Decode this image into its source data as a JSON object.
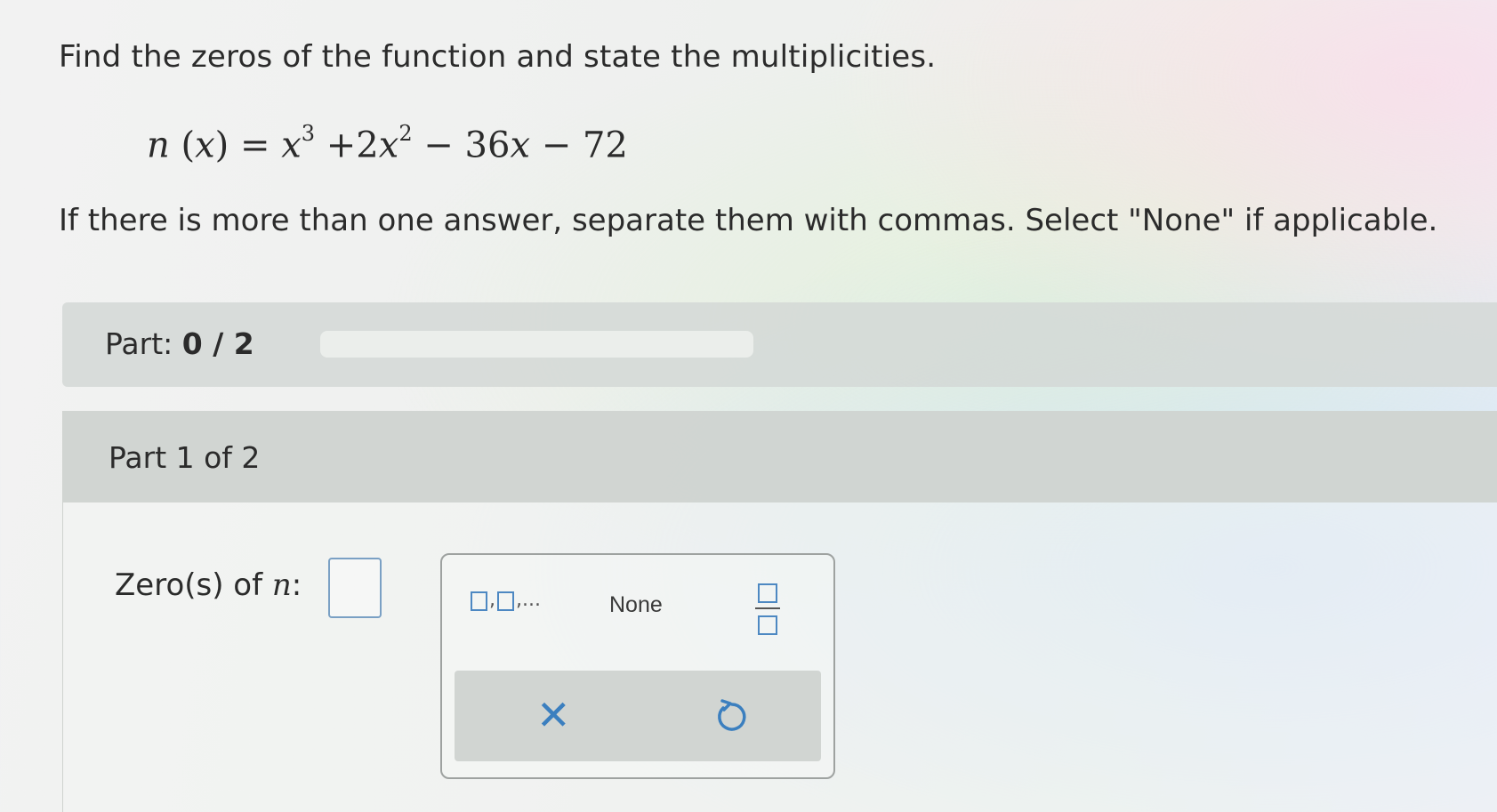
{
  "question": {
    "prompt": "Find the zeros of the function and state the multiplicities.",
    "instruction": "If there is more than one answer, separate them with commas. Select \"None\" if applicable."
  },
  "equation": {
    "fn": "n",
    "var": "x",
    "lhs_open": " (",
    "lhs_close": ")",
    "eq": " = ",
    "t1": "x",
    "e1": "3",
    "t2_plus": " +2",
    "t2": "x",
    "e2": "2",
    "t3": " − 36",
    "t3_var": "x",
    "t4": " − 72"
  },
  "progress": {
    "label": "Part:",
    "value": "0 / 2",
    "completed": 0,
    "total": 2
  },
  "part": {
    "title": "Part 1 of 2",
    "answer_label": "Zero(s) of",
    "answer_fn": "n",
    "answer_colon": ":",
    "answer_value": ""
  },
  "keypad": {
    "list_suffix": ",...",
    "none_label": "None",
    "clear_symbol": "✕",
    "colors": {
      "accent": "#3b7fbf",
      "box": "#4d88c2"
    }
  }
}
